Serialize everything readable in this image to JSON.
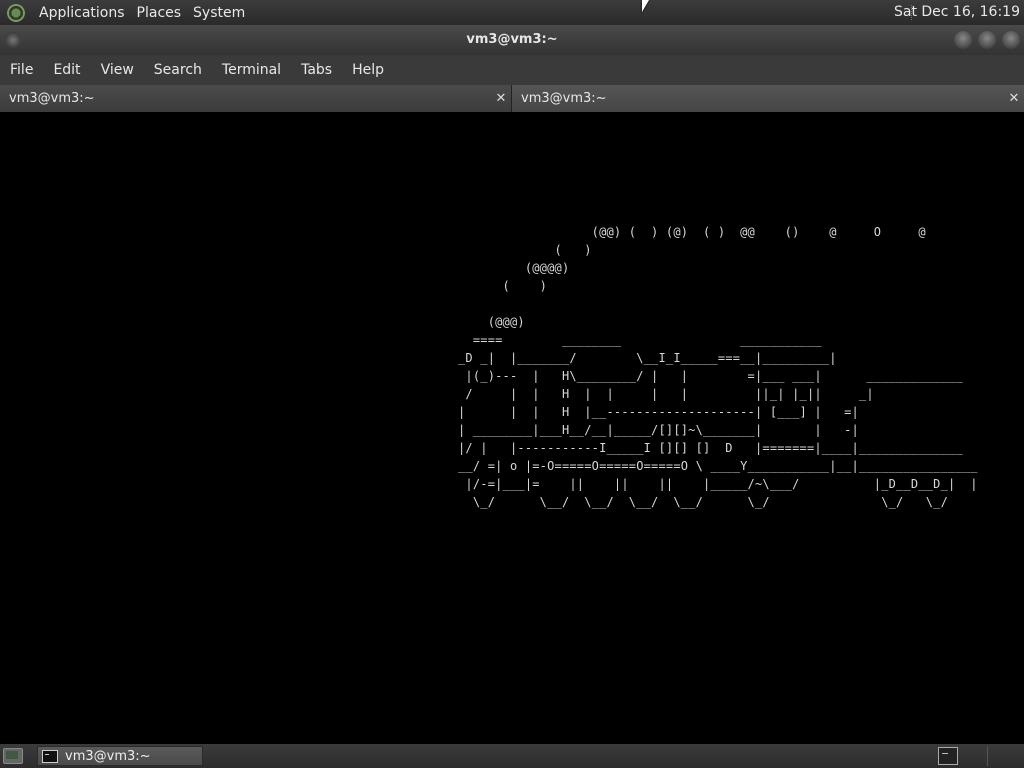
{
  "top_panel": {
    "menus": [
      "Applications",
      "Places",
      "System"
    ],
    "clock": "Sat Dec 16, 16:19",
    "logo_icon": "mate-logo-icon"
  },
  "window": {
    "title": "vm3@vm3:~",
    "menus": [
      "File",
      "Edit",
      "View",
      "Search",
      "Terminal",
      "Tabs",
      "Help"
    ],
    "tabs": [
      {
        "label": "vm3@vm3:~",
        "active": false
      },
      {
        "label": "vm3@vm3:~",
        "active": true
      }
    ],
    "close_glyph": "✕"
  },
  "terminal": {
    "lines": [
      "                  (@@) (  ) (@)  ( )  @@    ()    @     O     @",
      "             (   )",
      "         (@@@@)",
      "      (    )",
      "",
      "    (@@@)",
      "  ====        ________                ___________",
      "_D _|  |_______/        \\__I_I_____===__|_________|",
      " |(_)---  |   H\\________/ |   |        =|___ ___|      _____________",
      " /     |  |   H  |  |     |   |         ||_| |_||     _|",
      "|      |  |   H  |__--------------------| [___] |   =|",
      "| ________|___H__/__|_____/[][]~\\_______|       |   -|",
      "|/ |   |-----------I_____I [][] []  D   |=======|____|______________",
      "__/ =| o |=-O=====O=====O=====O \\ ____Y___________|__|________________",
      " |/-=|___|=    ||    ||    ||    |_____/~\\___/          |_D__D__D_|  |",
      "  \\_/      \\__/  \\__/  \\__/  \\__/      \\_/               \\_/   \\_/"
    ],
    "background": "#000000",
    "foreground": "#d8d8d8"
  },
  "bottom_panel": {
    "task_label": "vm3@vm3:~"
  }
}
